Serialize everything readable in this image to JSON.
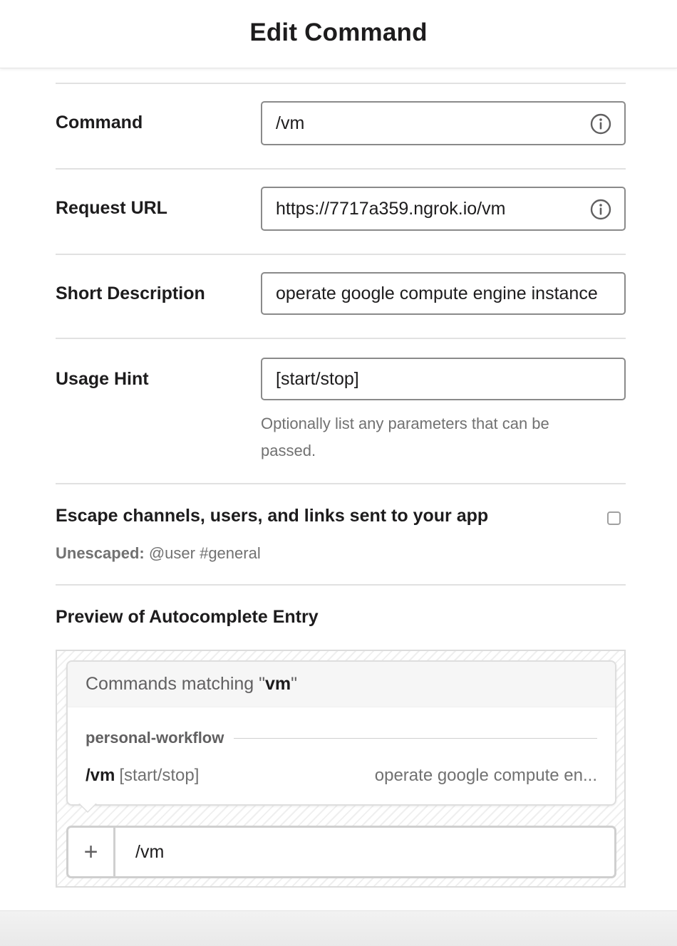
{
  "header": {
    "title": "Edit Command"
  },
  "form": {
    "command": {
      "label": "Command",
      "value": "/vm"
    },
    "request_url": {
      "label": "Request URL",
      "value": "https://7717a359.ngrok.io/vm"
    },
    "short_description": {
      "label": "Short Description",
      "value": "operate google compute engine instance"
    },
    "usage_hint": {
      "label": "Usage Hint",
      "value": "[start/stop]",
      "help": "Optionally list any parameters that can be passed."
    },
    "escape": {
      "label": "Escape channels, users, and links sent to your app",
      "checked": false,
      "unescaped_label": "Unescaped:",
      "unescaped_example": "@user #general"
    }
  },
  "preview": {
    "label": "Preview of Autocomplete Entry",
    "header_prefix": "Commands matching \"",
    "header_query": "vm",
    "header_suffix": "\"",
    "group_name": "personal-workflow",
    "item": {
      "command": "/vm",
      "hint": "[start/stop]",
      "description": "operate google compute en..."
    },
    "input_plus": "+",
    "input_text": "/vm"
  }
}
